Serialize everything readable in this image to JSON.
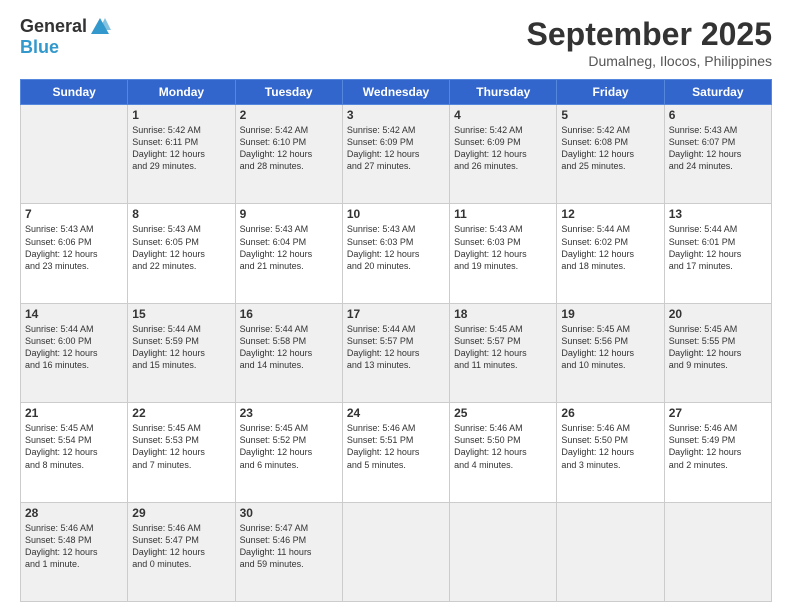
{
  "header": {
    "logo_general": "General",
    "logo_blue": "Blue",
    "month_title": "September 2025",
    "location": "Dumalneg, Ilocos, Philippines"
  },
  "weekdays": [
    "Sunday",
    "Monday",
    "Tuesday",
    "Wednesday",
    "Thursday",
    "Friday",
    "Saturday"
  ],
  "weeks": [
    [
      {
        "day": "",
        "info": ""
      },
      {
        "day": "1",
        "info": "Sunrise: 5:42 AM\nSunset: 6:11 PM\nDaylight: 12 hours\nand 29 minutes."
      },
      {
        "day": "2",
        "info": "Sunrise: 5:42 AM\nSunset: 6:10 PM\nDaylight: 12 hours\nand 28 minutes."
      },
      {
        "day": "3",
        "info": "Sunrise: 5:42 AM\nSunset: 6:09 PM\nDaylight: 12 hours\nand 27 minutes."
      },
      {
        "day": "4",
        "info": "Sunrise: 5:42 AM\nSunset: 6:09 PM\nDaylight: 12 hours\nand 26 minutes."
      },
      {
        "day": "5",
        "info": "Sunrise: 5:42 AM\nSunset: 6:08 PM\nDaylight: 12 hours\nand 25 minutes."
      },
      {
        "day": "6",
        "info": "Sunrise: 5:43 AM\nSunset: 6:07 PM\nDaylight: 12 hours\nand 24 minutes."
      }
    ],
    [
      {
        "day": "7",
        "info": "Sunrise: 5:43 AM\nSunset: 6:06 PM\nDaylight: 12 hours\nand 23 minutes."
      },
      {
        "day": "8",
        "info": "Sunrise: 5:43 AM\nSunset: 6:05 PM\nDaylight: 12 hours\nand 22 minutes."
      },
      {
        "day": "9",
        "info": "Sunrise: 5:43 AM\nSunset: 6:04 PM\nDaylight: 12 hours\nand 21 minutes."
      },
      {
        "day": "10",
        "info": "Sunrise: 5:43 AM\nSunset: 6:03 PM\nDaylight: 12 hours\nand 20 minutes."
      },
      {
        "day": "11",
        "info": "Sunrise: 5:43 AM\nSunset: 6:03 PM\nDaylight: 12 hours\nand 19 minutes."
      },
      {
        "day": "12",
        "info": "Sunrise: 5:44 AM\nSunset: 6:02 PM\nDaylight: 12 hours\nand 18 minutes."
      },
      {
        "day": "13",
        "info": "Sunrise: 5:44 AM\nSunset: 6:01 PM\nDaylight: 12 hours\nand 17 minutes."
      }
    ],
    [
      {
        "day": "14",
        "info": "Sunrise: 5:44 AM\nSunset: 6:00 PM\nDaylight: 12 hours\nand 16 minutes."
      },
      {
        "day": "15",
        "info": "Sunrise: 5:44 AM\nSunset: 5:59 PM\nDaylight: 12 hours\nand 15 minutes."
      },
      {
        "day": "16",
        "info": "Sunrise: 5:44 AM\nSunset: 5:58 PM\nDaylight: 12 hours\nand 14 minutes."
      },
      {
        "day": "17",
        "info": "Sunrise: 5:44 AM\nSunset: 5:57 PM\nDaylight: 12 hours\nand 13 minutes."
      },
      {
        "day": "18",
        "info": "Sunrise: 5:45 AM\nSunset: 5:57 PM\nDaylight: 12 hours\nand 11 minutes."
      },
      {
        "day": "19",
        "info": "Sunrise: 5:45 AM\nSunset: 5:56 PM\nDaylight: 12 hours\nand 10 minutes."
      },
      {
        "day": "20",
        "info": "Sunrise: 5:45 AM\nSunset: 5:55 PM\nDaylight: 12 hours\nand 9 minutes."
      }
    ],
    [
      {
        "day": "21",
        "info": "Sunrise: 5:45 AM\nSunset: 5:54 PM\nDaylight: 12 hours\nand 8 minutes."
      },
      {
        "day": "22",
        "info": "Sunrise: 5:45 AM\nSunset: 5:53 PM\nDaylight: 12 hours\nand 7 minutes."
      },
      {
        "day": "23",
        "info": "Sunrise: 5:45 AM\nSunset: 5:52 PM\nDaylight: 12 hours\nand 6 minutes."
      },
      {
        "day": "24",
        "info": "Sunrise: 5:46 AM\nSunset: 5:51 PM\nDaylight: 12 hours\nand 5 minutes."
      },
      {
        "day": "25",
        "info": "Sunrise: 5:46 AM\nSunset: 5:50 PM\nDaylight: 12 hours\nand 4 minutes."
      },
      {
        "day": "26",
        "info": "Sunrise: 5:46 AM\nSunset: 5:50 PM\nDaylight: 12 hours\nand 3 minutes."
      },
      {
        "day": "27",
        "info": "Sunrise: 5:46 AM\nSunset: 5:49 PM\nDaylight: 12 hours\nand 2 minutes."
      }
    ],
    [
      {
        "day": "28",
        "info": "Sunrise: 5:46 AM\nSunset: 5:48 PM\nDaylight: 12 hours\nand 1 minute."
      },
      {
        "day": "29",
        "info": "Sunrise: 5:46 AM\nSunset: 5:47 PM\nDaylight: 12 hours\nand 0 minutes."
      },
      {
        "day": "30",
        "info": "Sunrise: 5:47 AM\nSunset: 5:46 PM\nDaylight: 11 hours\nand 59 minutes."
      },
      {
        "day": "",
        "info": ""
      },
      {
        "day": "",
        "info": ""
      },
      {
        "day": "",
        "info": ""
      },
      {
        "day": "",
        "info": ""
      }
    ]
  ]
}
